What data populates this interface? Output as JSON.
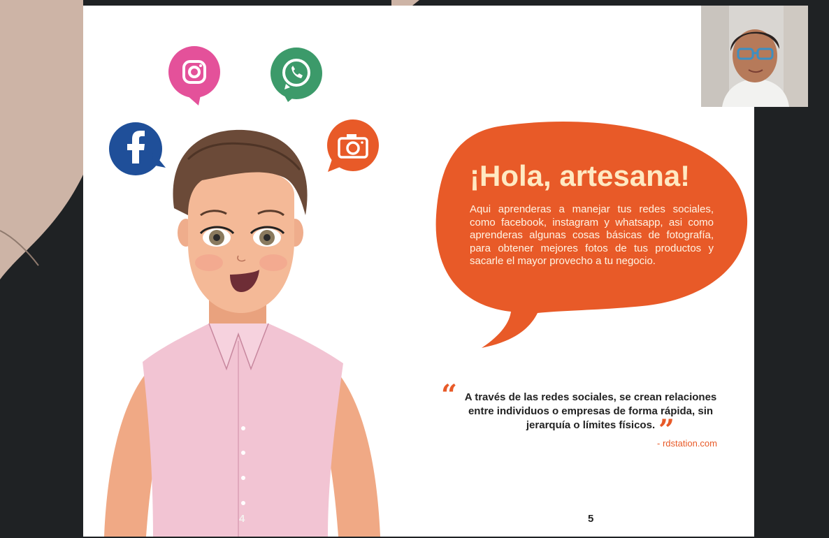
{
  "slide": {
    "title": "¡Hola, artesana!",
    "body": "Aqui aprenderas a manejar tus redes sociales, como facebook, instagram y whatsapp, asi como aprenderas algunas cosas básicas de fotografía, para obtener mejores fotos de tus productos y sacarle el mayor provecho a tu negocio.",
    "quote": "A través de las redes sociales, se crean relaciones entre individuos o empresas de forma rápida, sin jerarquía o límites físicos.",
    "quote_open_mark": "“",
    "quote_close_mark": "”",
    "source": "- rdstation.com",
    "page_left": "4",
    "page_right": "5",
    "icons": [
      "instagram-icon",
      "whatsapp-icon",
      "facebook-icon",
      "camera-icon"
    ]
  },
  "colors": {
    "accent_orange": "#e85a28",
    "instagram": "#e4519a",
    "whatsapp": "#3c9a6a",
    "facebook": "#1f4f99",
    "title": "#ffe9c2",
    "background": "#1f2224",
    "shirt": "#f2c4d3"
  }
}
